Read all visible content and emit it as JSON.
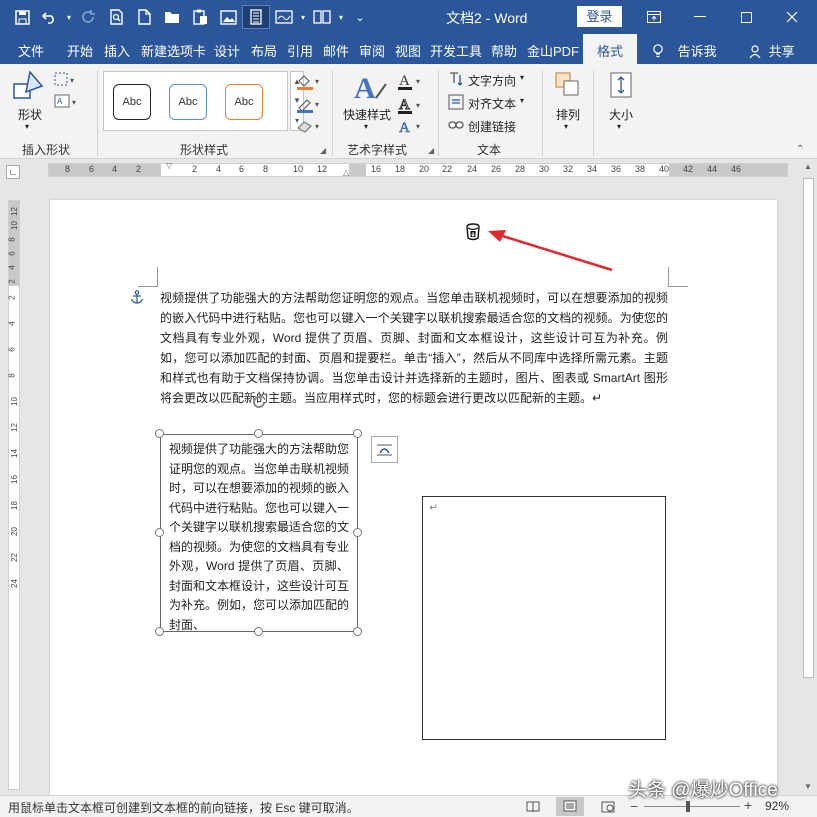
{
  "titlebar": {
    "doc_title": "文档2 - Word",
    "login_label": "登录",
    "qat_icons": [
      "save-icon",
      "undo-icon",
      "redo-icon",
      "print-preview-icon",
      "new-doc-icon",
      "open-icon",
      "paste-icon",
      "image-icon",
      "read-mode-icon",
      "layout-icon",
      "columns-icon",
      "more-icon"
    ]
  },
  "tabs": [
    "文件",
    "开始",
    "插入",
    "新建选项卡",
    "设计",
    "布局",
    "引用",
    "邮件",
    "审阅",
    "视图",
    "开发工具",
    "帮助",
    "金山PDF",
    "格式"
  ],
  "tell_me": "告诉我",
  "share": "共享",
  "ribbon": {
    "shape_label": "形状",
    "group_insert_shape": "插入形状",
    "group_shape_style": "形状样式",
    "style_sample": "Abc",
    "quick_style": "快速样式",
    "group_wordart": "艺术字样式",
    "text_direction": "文字方向",
    "align_text": "对齐文本",
    "create_link": "创建链接",
    "group_text": "文本",
    "arrange": "排列",
    "size": "大小"
  },
  "ruler": {
    "h_left": [
      "8",
      "6",
      "4",
      "2"
    ],
    "h_right": [
      "2",
      "4",
      "6",
      "8",
      "10",
      "12",
      "16",
      "18",
      "20",
      "22",
      "24",
      "26",
      "28",
      "30",
      "32",
      "34",
      "36",
      "38",
      "40",
      "42",
      "44",
      "46"
    ],
    "v": [
      "12",
      "10",
      "8",
      "6",
      "4",
      "2",
      "2",
      "4",
      "6",
      "8",
      "10",
      "12",
      "14",
      "16",
      "18",
      "20",
      "22",
      "24"
    ]
  },
  "document": {
    "paragraph": "视频提供了功能强大的方法帮助您证明您的观点。当您单击联机视频时，可以在想要添加的视频的嵌入代码中进行粘贴。您也可以键入一个关键字以联机搜索最适合您的文档的视频。为使您的文档具有专业外观，Word 提供了页眉、页脚、封面和文本框设计，这些设计可互为补充。例如，您可以添加匹配的封面、页眉和提要栏。单击“插入”，然后从不同库中选择所需元素。主题和样式也有助于文档保持协调。当您单击设计并选择新的主题时，图片、图表或 SmartArt 图形将会更改以匹配新的主题。当应用样式时，您的标题会进行更改以匹配新的主题。↵",
    "textbox1": "视频提供了功能强大的方法帮助您证明您的观点。当您单击联机视频时，可以在想要添加的视频的嵌入代码中进行粘贴。您也可以键入一个关键字以联机搜索最适合您的文档的视频。为使您的文档具有专业外观，Word 提供了页眉、页脚、封面和文本框设计，这些设计可互为补充。例如，您可以添加匹配的封面、",
    "textbox2": "↵"
  },
  "status": {
    "message": "用鼠标单击文本框可创建到文本框的前向链接，按 Esc 键可取消。",
    "zoom": "92%",
    "zoom_fraction": 0.46
  },
  "watermark": "头条 @爆炒Office",
  "colors": {
    "accent": "#2b579a",
    "arrow": "#e0282e"
  }
}
